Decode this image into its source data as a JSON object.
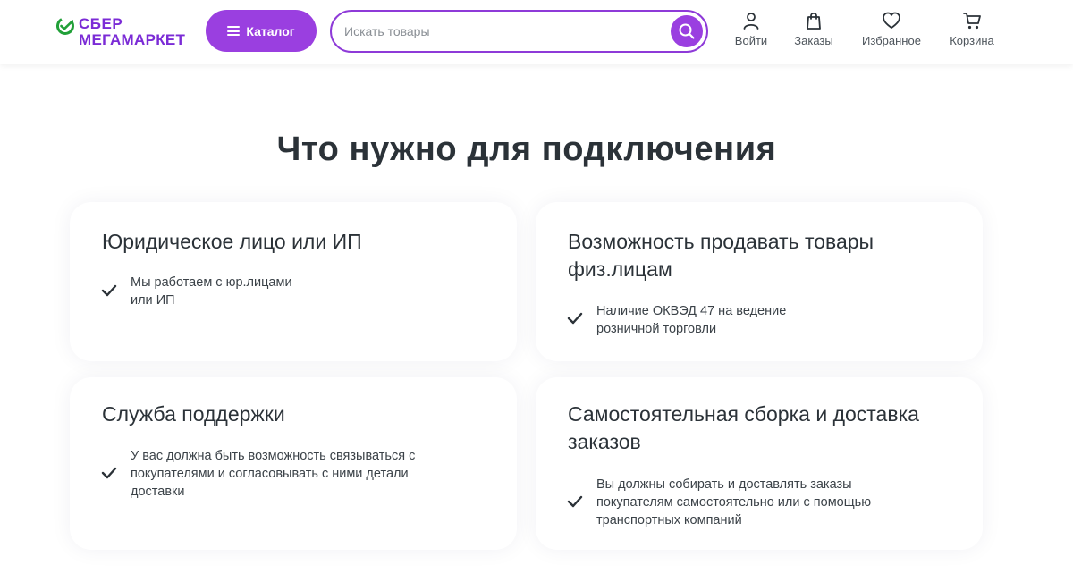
{
  "header": {
    "logo": {
      "line1": "СБЕР",
      "line2": "МЕГАМАРКЕТ"
    },
    "catalog_label": "Каталог",
    "search": {
      "placeholder": "Искать товары",
      "value": ""
    },
    "nav": [
      {
        "label": "Войти",
        "icon": "user-icon"
      },
      {
        "label": "Заказы",
        "icon": "bag-icon"
      },
      {
        "label": "Избранное",
        "icon": "heart-icon"
      },
      {
        "label": "Корзина",
        "icon": "cart-icon"
      }
    ]
  },
  "main": {
    "title": "Что нужно для подключения",
    "cards": [
      {
        "title": "Юридическое лицо или ИП",
        "text": "Мы работаем с юр.лицами или ИП"
      },
      {
        "title": "Возможность продавать товары физ.лицам",
        "text": "Наличие ОКВЭД 47 на ведение розничной торговли"
      },
      {
        "title": "Служба поддержки",
        "text": "У вас должна быть возможность связываться с покупателями и согласовывать с ними детали доставки"
      },
      {
        "title": "Самостоятельная сборка и доставка заказов",
        "text": "Вы должны собирать и доставлять заказы покупателям самостоятельно или с помощью транспортных компаний"
      }
    ]
  },
  "colors": {
    "accent": "#9a3fe0",
    "logo_green": "#21a038",
    "text": "#2b3238"
  }
}
